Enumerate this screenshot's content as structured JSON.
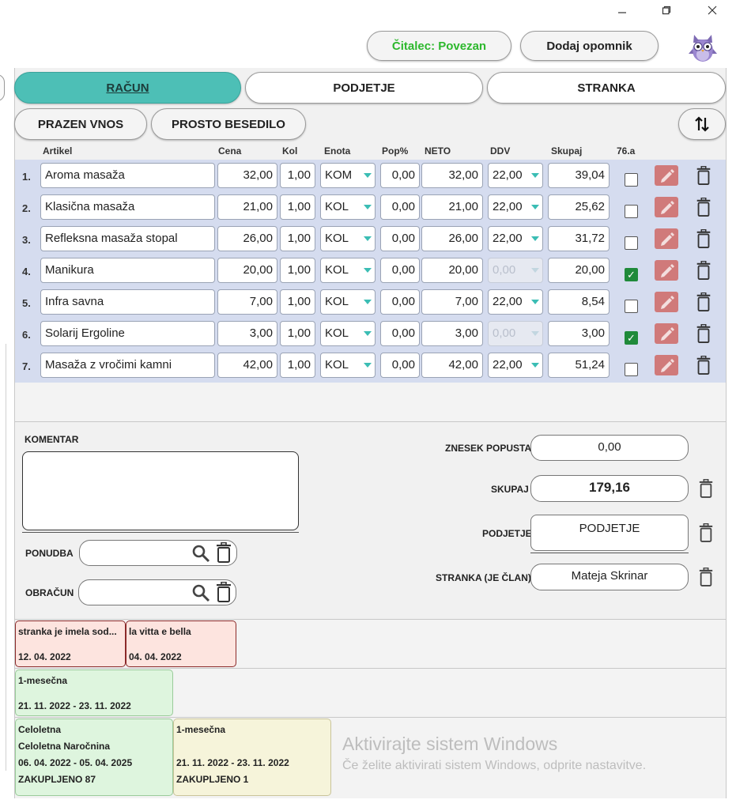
{
  "window": {
    "minimize_icon": "minimize-icon",
    "maximize_icon": "maximize-icon",
    "close_icon": "close-icon"
  },
  "header": {
    "reader_status": "Čitalec: Povezan",
    "reader_status_color": "#2db82d",
    "add_reminder_label": "Dodaj opomnik",
    "mascot_icon": "owl-mascot-icon"
  },
  "tabs": [
    {
      "label": "RAČUN",
      "active": true
    },
    {
      "label": "PODJETJE",
      "active": false
    },
    {
      "label": "STRANKA",
      "active": false
    }
  ],
  "toolbar": {
    "empty_entry_label": "PRAZEN VNOS",
    "free_text_label": "PROSTO BESEDILO",
    "sort_icon": "sort-arrows-icon"
  },
  "columns": [
    "Artikel",
    "Cena",
    "Kol",
    "Enota",
    "Pop%",
    "NETO",
    "DDV",
    "Skupaj",
    "76.a"
  ],
  "rows": [
    {
      "num": "1.",
      "article": "Aroma masaža",
      "price": "32,00",
      "qty": "1,00",
      "unit": "KOM",
      "discount": "0,00",
      "net": "32,00",
      "vat": "22,00",
      "vat_disabled": false,
      "total": "39,04",
      "art76a": false
    },
    {
      "num": "2.",
      "article": "Klasična masaža",
      "price": "21,00",
      "qty": "1,00",
      "unit": "KOL",
      "discount": "0,00",
      "net": "21,00",
      "vat": "22,00",
      "vat_disabled": false,
      "total": "25,62",
      "art76a": false
    },
    {
      "num": "3.",
      "article": "Refleksna masaža stopal",
      "price": "26,00",
      "qty": "1,00",
      "unit": "KOL",
      "discount": "0,00",
      "net": "26,00",
      "vat": "22,00",
      "vat_disabled": false,
      "total": "31,72",
      "art76a": false
    },
    {
      "num": "4.",
      "article": "Manikura",
      "price": "20,00",
      "qty": "1,00",
      "unit": "KOL",
      "discount": "0,00",
      "net": "20,00",
      "vat": "0,00",
      "vat_disabled": true,
      "total": "20,00",
      "art76a": true
    },
    {
      "num": "5.",
      "article": "Infra savna",
      "price": "7,00",
      "qty": "1,00",
      "unit": "KOL",
      "discount": "0,00",
      "net": "7,00",
      "vat": "22,00",
      "vat_disabled": false,
      "total": "8,54",
      "art76a": false
    },
    {
      "num": "6.",
      "article": "Solarij Ergoline",
      "price": "3,00",
      "qty": "1,00",
      "unit": "KOL",
      "discount": "0,00",
      "net": "3,00",
      "vat": "0,00",
      "vat_disabled": true,
      "total": "3,00",
      "art76a": true
    },
    {
      "num": "7.",
      "article": "Masaža z vročimi kamni",
      "price": "42,00",
      "qty": "1,00",
      "unit": "KOL",
      "discount": "0,00",
      "net": "42,00",
      "vat": "22,00",
      "vat_disabled": false,
      "total": "51,24",
      "art76a": false
    }
  ],
  "bottom": {
    "comment_label": "KOMENTAR",
    "comment_value": "",
    "offer_label": "PONUDBA",
    "billing_label": "OBRAČUN",
    "discount_amount_label": "ZNESEK POPUSTA",
    "discount_amount_value": "0,00",
    "total_label": "SKUPAJ",
    "total_value": "179,16",
    "company_label": "PODJETJE",
    "company_value": "PODJETJE",
    "customer_label": "STRANKA (JE ČLAN)",
    "customer_value": "Mateja Skrinar"
  },
  "cards_row1": [
    {
      "title": "stranka je imela sod...",
      "date": "12. 04. 2022"
    },
    {
      "title": "la vitta e bella",
      "date": "04. 04. 2022"
    }
  ],
  "cards_row2": [
    {
      "title": "1-mesečna",
      "date": "21. 11. 2022 - 23. 11. 2022"
    }
  ],
  "cards_row3": [
    {
      "line1": "Celoletna",
      "line2": "Celoletna Naročnina",
      "line3": "06. 04. 2022 - 05. 04. 2025",
      "line4": "ZAKUPLJENO 87"
    },
    {
      "line1": "1-mesečna",
      "line2": "",
      "line3": "21. 11. 2022 - 23. 11. 2022",
      "line4": "ZAKUPLJENO 1"
    }
  ],
  "watermark": {
    "title": "Aktivirajte sistem Windows",
    "subtitle": "Če želite aktivirati sistem Windows, odprite nastavitve."
  }
}
